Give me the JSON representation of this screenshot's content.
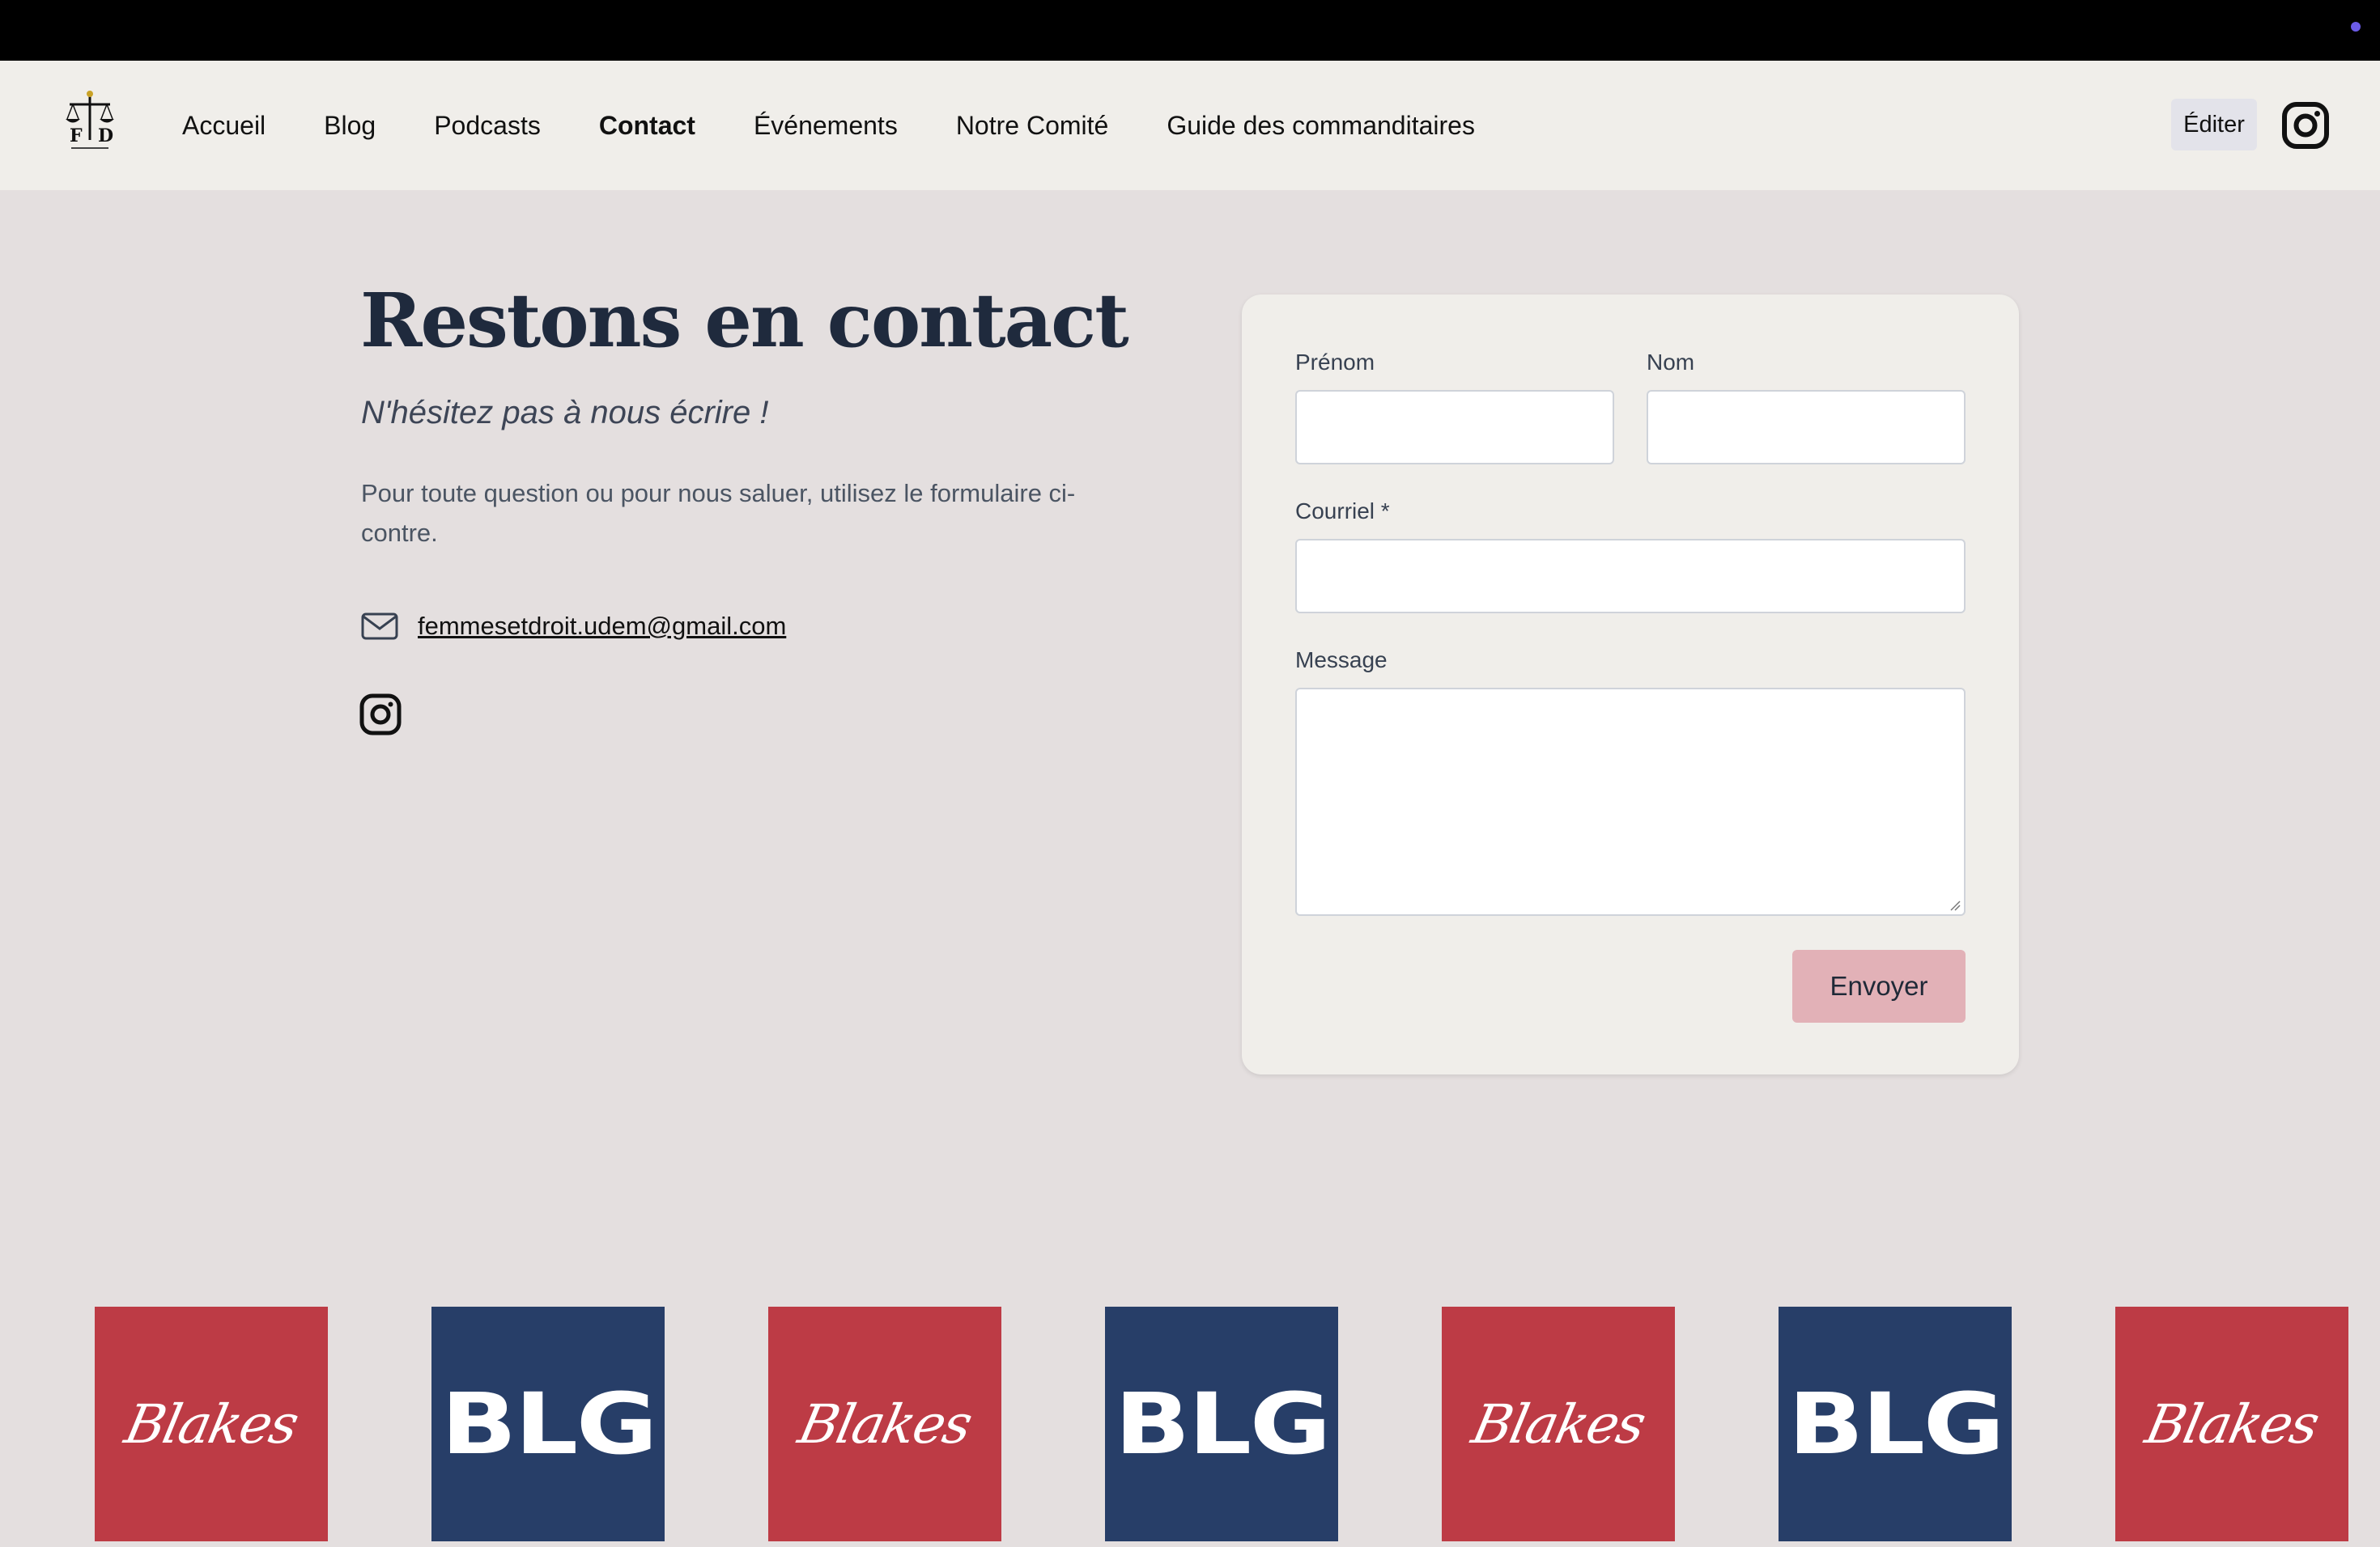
{
  "nav": {
    "links": [
      "Accueil",
      "Blog",
      "Podcasts",
      "Contact",
      "Événements",
      "Notre Comité",
      "Guide des commanditaires"
    ],
    "active": "Contact",
    "edit_label": "Éditer",
    "logo_icon": "scales-of-justice-icon",
    "social_icon": "instagram-icon"
  },
  "main": {
    "title": "Restons en contact",
    "subtitle": "N'hésitez pas à nous écrire !",
    "description": "Pour toute question ou pour nous saluer, utilisez le formulaire ci-contre.",
    "email": "femmesetdroit.udem@gmail.com"
  },
  "form": {
    "first_name_label": "Prénom",
    "last_name_label": "Nom",
    "email_label": "Courriel *",
    "message_label": "Message",
    "first_name_value": "",
    "last_name_value": "",
    "email_value": "",
    "message_value": "",
    "submit_label": "Envoyer"
  },
  "sponsors": {
    "tiles": [
      "Blakes",
      "BLG",
      "Blakes",
      "BLG",
      "Blakes",
      "BLG",
      "Blakes"
    ]
  },
  "colors": {
    "page_bg": "#e4dfdf",
    "nav_bg": "#f0eeea",
    "card_bg": "#f0eeea",
    "button_pink": "#e2b1b7",
    "blakes_red": "#bd3b45",
    "blg_navy": "#273e68"
  }
}
